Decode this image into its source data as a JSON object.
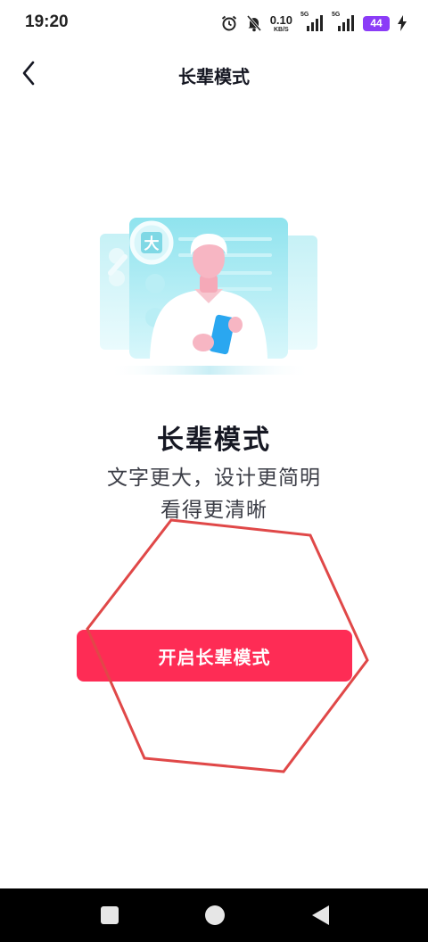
{
  "status_bar": {
    "time": "19:20",
    "net_speed_value": "0.10",
    "net_speed_unit": "KB/S",
    "sim1_label": "5G",
    "sim2_label": "5G",
    "battery": "44",
    "icons": [
      "alarm-icon",
      "mute-icon",
      "signal-icon",
      "signal-icon",
      "battery-icon",
      "charging-icon"
    ]
  },
  "header": {
    "title": "长辈模式",
    "back_icon": "back-chevron-icon"
  },
  "illustration": {
    "badge_char": "大"
  },
  "main": {
    "title": "长辈模式",
    "subtitle_line1": "文字更大，设计更简明",
    "subtitle_line2": "看得更清晰",
    "enable_button": "开启长辈模式"
  },
  "colors": {
    "accent": "#fe2c55",
    "annotation": "#e04848",
    "battery": "#8b3cf7"
  },
  "nav_bar": {
    "icons": [
      "recent-apps-icon",
      "home-icon",
      "back-icon"
    ]
  }
}
